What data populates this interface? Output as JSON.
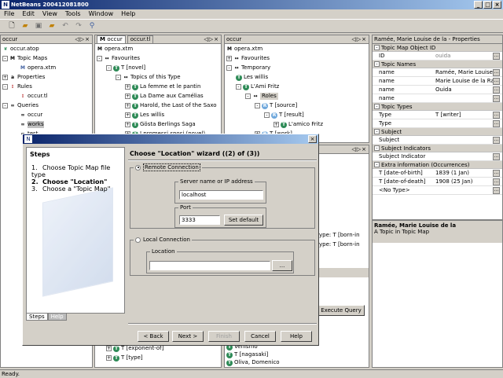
{
  "window": {
    "title": "NetBeans 200412081800"
  },
  "menu": [
    "File",
    "Edit",
    "View",
    "Tools",
    "Window",
    "Help"
  ],
  "toolbar": [
    "new-icon",
    "open-icon",
    "save-icon",
    "copy-icon",
    "undo-icon",
    "redo-icon",
    "search-icon"
  ],
  "left_panel": {
    "tab": "occur",
    "items": [
      {
        "label": "occur.atop",
        "depth": 0,
        "icon": "tm"
      },
      {
        "label": "Topic Maps",
        "depth": 0,
        "icon": "m"
      },
      {
        "label": "opera.xtm",
        "depth": 1,
        "icon": "file"
      },
      {
        "label": "Properties",
        "depth": 0,
        "icon": "aa"
      },
      {
        "label": "Rules",
        "depth": 0,
        "icon": "rule"
      },
      {
        "label": "occur.tl",
        "depth": 1,
        "icon": "rule"
      },
      {
        "label": "Queries",
        "depth": 0,
        "icon": "q"
      },
      {
        "label": "occur",
        "depth": 1,
        "icon": "q"
      },
      {
        "label": "works",
        "depth": 1,
        "icon": "q"
      },
      {
        "label": "test",
        "depth": 1,
        "icon": "q"
      }
    ]
  },
  "middle_panel": {
    "tabs": [
      "occur",
      "occur.tl"
    ],
    "items": [
      {
        "label": "opera.xtm",
        "depth": 0,
        "icon": "m"
      },
      {
        "label": "Favourites",
        "depth": 0,
        "icon": "arrow"
      },
      {
        "label": "T [novel]",
        "depth": 1,
        "icon": "t"
      },
      {
        "label": "Topics of this Type",
        "depth": 2,
        "icon": "arrow"
      },
      {
        "label": "La femme et le pantin",
        "depth": 3,
        "icon": "t"
      },
      {
        "label": "La Dame aux Camélias",
        "depth": 3,
        "icon": "t"
      },
      {
        "label": "Harold, the Last of the Saxo",
        "depth": 3,
        "icon": "t"
      },
      {
        "label": "Les willis",
        "depth": 3,
        "icon": "t"
      },
      {
        "label": "Gösta Berlings Saga",
        "depth": 3,
        "icon": "t"
      },
      {
        "label": "I promessi sposi (novel)",
        "depth": 3,
        "icon": "t"
      }
    ],
    "bottom_items": [
      {
        "label": "T [exponent-of]",
        "depth": 1,
        "icon": "t"
      },
      {
        "label": "T [type]",
        "depth": 1,
        "icon": "t"
      }
    ]
  },
  "right_tree": {
    "tab": "occur",
    "items": [
      {
        "label": "opera.xtm",
        "depth": 0,
        "icon": "m"
      },
      {
        "label": "Favourites",
        "depth": 0,
        "icon": "arrow"
      },
      {
        "label": "Temporary",
        "depth": 0,
        "icon": "arrow"
      },
      {
        "label": "Les willis",
        "depth": 1,
        "icon": "t"
      },
      {
        "label": "L'Ami Fritz",
        "depth": 1,
        "icon": "t"
      },
      {
        "label": "Roles",
        "depth": 2,
        "icon": "arrow"
      },
      {
        "label": "T [source]",
        "depth": 3,
        "icon": "r"
      },
      {
        "label": "T [result]",
        "depth": 4,
        "icon": "r"
      },
      {
        "label": "L'amico Fritz",
        "depth": 5,
        "icon": "t"
      },
      {
        "label": "T [work]",
        "depth": 3,
        "icon": "r"
      }
    ],
    "partial_lines": [
      "ype: T [born-in",
      "ype: T [born-in"
    ],
    "bottom_items": [
      {
        "label": "Venismo",
        "depth": 1,
        "icon": "t"
      },
      {
        "label": "T [nagasaki]",
        "depth": 1,
        "icon": "t"
      },
      {
        "label": "Oliva, Domenico",
        "depth": 1,
        "icon": "t"
      }
    ],
    "execute_button": "Execute Query"
  },
  "properties": {
    "title": "Ramée, Marie Louise de la - Properties",
    "sections": [
      {
        "name": "Topic Map Object ID",
        "rows": [
          {
            "k": "ID",
            "v": "ouida"
          }
        ]
      },
      {
        "name": "Topic Names",
        "rows": [
          {
            "k": "name",
            "v": "Ramée, Marie Louise de"
          },
          {
            "k": "name",
            "v": "Marie Louise de la Ramé"
          },
          {
            "k": "name",
            "v": "Ouida"
          },
          {
            "k": "name",
            "v": ""
          }
        ]
      },
      {
        "name": "Topic Types",
        "rows": [
          {
            "k": "Type",
            "v": "T [writer]"
          },
          {
            "k": "Type",
            "v": ""
          }
        ]
      },
      {
        "name": "Subject",
        "rows": [
          {
            "k": "Subject",
            "v": ""
          }
        ]
      },
      {
        "name": "Subject Indicators",
        "rows": [
          {
            "k": "Subject Indicator",
            "v": ""
          }
        ]
      },
      {
        "name": "Extra information (Occurrences)",
        "rows": [
          {
            "k": "T [date-of-birth]",
            "v": "1839 (1 Jan)"
          },
          {
            "k": "T [date-of-death]",
            "v": "1908 (25 Jan)"
          },
          {
            "k": "<No Type>",
            "v": ""
          }
        ]
      }
    ],
    "summary_title": "Ramée, Marie Louise de la",
    "summary_text": "A Topic in Topic Map"
  },
  "wizard": {
    "title": "",
    "steps_heading": "Steps",
    "steps": [
      {
        "n": "1.",
        "label": "Choose Topic Map file type",
        "current": false
      },
      {
        "n": "2.",
        "label": "Choose \"Location\"",
        "current": true
      },
      {
        "n": "3.",
        "label": "Choose a \"Topic Map\"",
        "current": false
      }
    ],
    "tabs": [
      "Steps",
      "Help"
    ],
    "heading": "Choose \"Location\" wizard ((2) of (3))",
    "remote_label": "Remote Connection",
    "server_label": "Server name or IP address",
    "server_value": "localhost",
    "port_label": "Port",
    "port_value": "3333",
    "set_default": "Set default",
    "local_label": "Local Connection",
    "location_label": "Location",
    "location_value": "",
    "browse": "...",
    "buttons": {
      "back": "< Back",
      "next": "Next >",
      "finish": "Finish",
      "cancel": "Cancel",
      "help": "Help"
    }
  },
  "status": "Ready."
}
